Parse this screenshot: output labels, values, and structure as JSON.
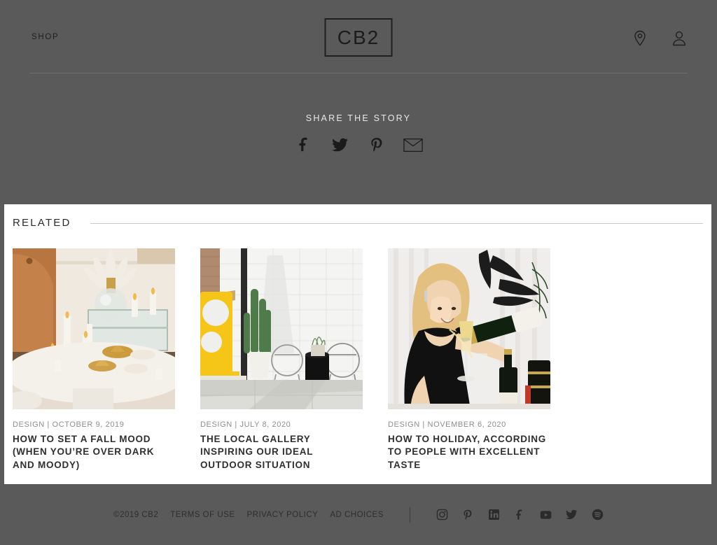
{
  "header": {
    "shop_label": "SHOP",
    "brand": "CB2",
    "icons": [
      {
        "name": "location-pin-icon"
      },
      {
        "name": "user-account-icon"
      }
    ]
  },
  "share": {
    "title": "SHARE THE STORY",
    "icons": [
      {
        "name": "facebook-icon"
      },
      {
        "name": "twitter-icon"
      },
      {
        "name": "pinterest-icon"
      },
      {
        "name": "email-icon"
      }
    ]
  },
  "related": {
    "heading": "RELATED",
    "cards": [
      {
        "category": "DESIGN",
        "separator": "|",
        "date": "OCTOBER 9, 2019",
        "meta": "DESIGN | OCTOBER 9, 2019",
        "title": "HOW TO SET A FALL MOOD (WHEN YOU’RE OVER DARK AND MOODY)",
        "image_alt": "candlelit-table-with-pampas-grass-and-mirrored-tray"
      },
      {
        "category": "DESIGN",
        "separator": "|",
        "date": "JULY 8, 2020",
        "meta": "DESIGN | JULY 8, 2020",
        "title": "THE LOCAL GALLERY INSPIRING OUR IDEAL OUTDOOR SITUATION",
        "image_alt": "white-brick-patio-with-yellow-sculpture-cactus-and-wire-chairs"
      },
      {
        "category": "DESIGN",
        "separator": "|",
        "date": "NOVEMBER 6, 2020",
        "meta": "DESIGN | NOVEMBER 6, 2020",
        "title": "HOW TO HOLIDAY, ACCORDING TO PEOPLE WITH EXCELLENT TASTE",
        "image_alt": "woman-in-black-dress-pouring-champagne"
      }
    ]
  },
  "footer": {
    "copyright": "©2019 CB2",
    "links": [
      {
        "label": "TERMS OF USE"
      },
      {
        "label": "PRIVACY POLICY"
      },
      {
        "label": "AD CHOICES"
      }
    ],
    "social": [
      {
        "name": "instagram-icon"
      },
      {
        "name": "pinterest-icon"
      },
      {
        "name": "linkedin-icon"
      },
      {
        "name": "facebook-icon"
      },
      {
        "name": "youtube-icon"
      },
      {
        "name": "twitter-icon"
      },
      {
        "name": "spotify-icon"
      }
    ]
  },
  "colors": {
    "page_background": "#5a5a5a",
    "panel_background": "#ffffff",
    "dark_text": "#1f1f1f",
    "card_title": "#2f2f2f",
    "card_meta": "#8d8d8d",
    "rule": "#c9c9c9"
  }
}
